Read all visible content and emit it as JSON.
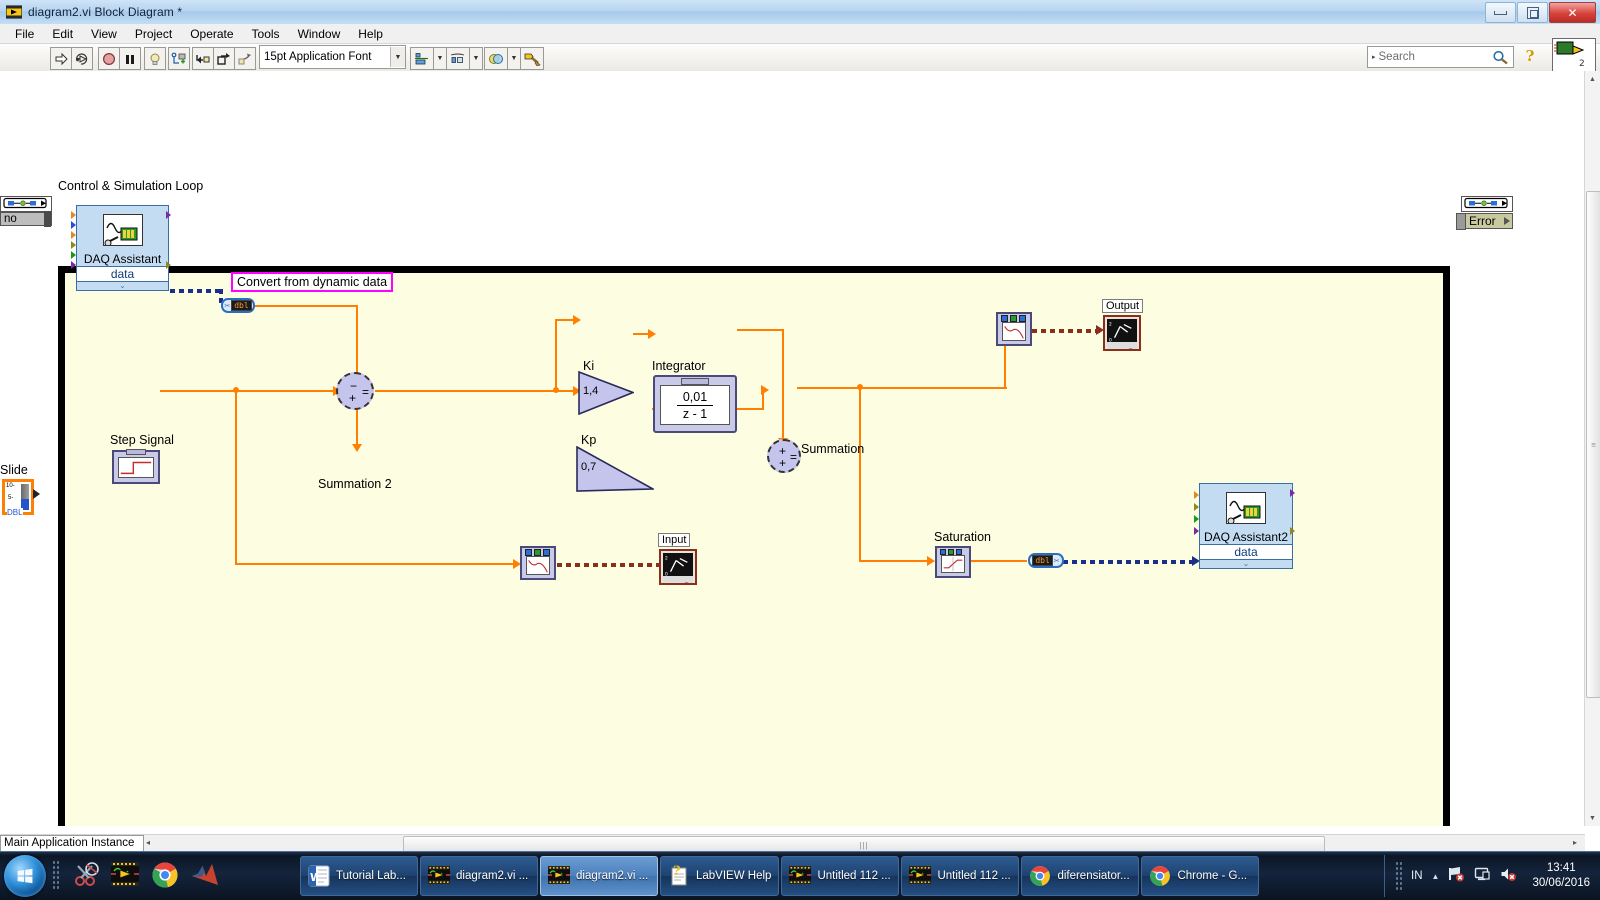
{
  "window": {
    "title": "diagram2.vi Block Diagram *",
    "app_icon": "labview-vi-icon",
    "minimize_label": "–",
    "restore_label": "❐",
    "close_label": "✕"
  },
  "menu": {
    "items": [
      "File",
      "Edit",
      "View",
      "Project",
      "Operate",
      "Tools",
      "Window",
      "Help"
    ]
  },
  "toolbar": {
    "buttons": [
      {
        "name": "run-button",
        "icon": "run-arrow-icon"
      },
      {
        "name": "run-continuously-button",
        "icon": "run-continuous-icon"
      },
      {
        "name": "abort-execution-button",
        "icon": "abort-stop-icon"
      },
      {
        "name": "pause-button",
        "icon": "pause-icon"
      },
      {
        "name": "highlight-execution-button",
        "icon": "lightbulb-icon"
      },
      {
        "name": "retain-wire-values-button",
        "icon": "retain-wire-values-icon"
      },
      {
        "name": "step-into-button",
        "icon": "step-into-icon"
      },
      {
        "name": "step-over-button",
        "icon": "step-over-icon"
      },
      {
        "name": "step-out-button",
        "icon": "step-out-icon"
      }
    ],
    "font_selector": {
      "value": "15pt Application Font",
      "arrow": "▼"
    },
    "align_objects": {
      "name": "align-objects-button",
      "arrow": "▼"
    },
    "distribute_objects": {
      "name": "distribute-objects-button",
      "arrow": "▼"
    },
    "reorder": {
      "name": "reorder-button",
      "arrow": "▼"
    },
    "clean_up_diagram": {
      "name": "clean-up-diagram-button"
    },
    "search": {
      "placeholder": "Search",
      "icon": "magnifier-icon",
      "arrow": "▸"
    },
    "help_button": {
      "label": "?"
    },
    "context_help": {
      "name": "context-help-window"
    }
  },
  "diagram": {
    "loop_label": "Control & Simulation Loop",
    "nodes": {
      "daq_assistant": {
        "title": "DAQ Assistant",
        "output_label": "data",
        "chevron": "»"
      },
      "daq_assistant2": {
        "title": "DAQ Assistant2",
        "output_label": "data",
        "chevron": "»"
      },
      "convert_label": "Convert from dynamic data",
      "convert_node_1": {
        "type_text": "dbl"
      },
      "convert_node_2": {
        "type_text": "dbl"
      },
      "step_signal": {
        "label": "Step Signal"
      },
      "summation2": {
        "label": "Summation 2",
        "sign_top": "−",
        "sign_bottom": "+",
        "sign_out": "="
      },
      "summation": {
        "label": "Summation",
        "sign_top": "+",
        "sign_bottom": "+",
        "sign_out": "="
      },
      "gain_ki": {
        "label": "Ki",
        "value": "1,4"
      },
      "gain_kp": {
        "label": "Kp",
        "value": "0,7"
      },
      "integrator": {
        "label": "Integrator",
        "numerator": "0,01",
        "denominator": "z - 1"
      },
      "saturation": {
        "label": "Saturation"
      },
      "indicator_output": {
        "label": "Output"
      },
      "indicator_input": {
        "label": "Input"
      }
    },
    "left_terminals": {
      "error_in_cluster": "error-cluster-icon",
      "error_in_value": "no",
      "slide_control": {
        "label": "Slide",
        "type": "DBL",
        "ticks": [
          "10-",
          "5-"
        ]
      }
    },
    "right_terminals": {
      "error_out_cluster": "error-cluster-icon",
      "error_out_label": "Error"
    }
  },
  "status": {
    "application_instance": "Main Application Instance",
    "scroll_left_arrow": "◂",
    "scroll_right_arrow": "▸",
    "h_scroll_grip": "|||",
    "v_scroll_up": "▲",
    "v_scroll_down": "▼",
    "v_scroll_grip": "≡"
  },
  "taskbar": {
    "start_button": "windows-start-orb",
    "quick_launch": [
      {
        "name": "snipping-tool-icon"
      },
      {
        "name": "labview-icon"
      },
      {
        "name": "google-chrome-icon"
      },
      {
        "name": "matlab-icon"
      }
    ],
    "tasks": [
      {
        "label": "Tutorial Lab...",
        "icon": "word-document-icon",
        "active": false
      },
      {
        "label": "diagram2.vi ...",
        "icon": "labview-vi-icon",
        "active": false
      },
      {
        "label": "diagram2.vi ...",
        "icon": "labview-vi-icon",
        "active": true
      },
      {
        "label": "LabVIEW Help",
        "icon": "help-document-icon",
        "active": false
      },
      {
        "label": "Untitled 112 ...",
        "icon": "labview-vi-icon",
        "active": false
      },
      {
        "label": "Untitled 112 ...",
        "icon": "labview-vi-icon",
        "active": false
      },
      {
        "label": "diferensiator...",
        "icon": "google-chrome-icon",
        "active": false
      },
      {
        "label": "Chrome - G...",
        "icon": "google-chrome-icon",
        "active": false
      }
    ],
    "tray": {
      "language": "IN",
      "show_hidden_arrow": "▲",
      "icons": [
        "network-error-icon",
        "display-icon",
        "volume-muted-icon"
      ],
      "time": "13:41",
      "date": "30/06/2016"
    }
  },
  "colors": {
    "wire_orange": "#ff8000",
    "diagram_background": "#fdfde2",
    "express_vi_blue": "#c3dcf2",
    "dynamic_wire_blue": "#1b2f8a",
    "indicator_brown": "#8b2f1d",
    "free_label_border": "#ff00ff"
  }
}
